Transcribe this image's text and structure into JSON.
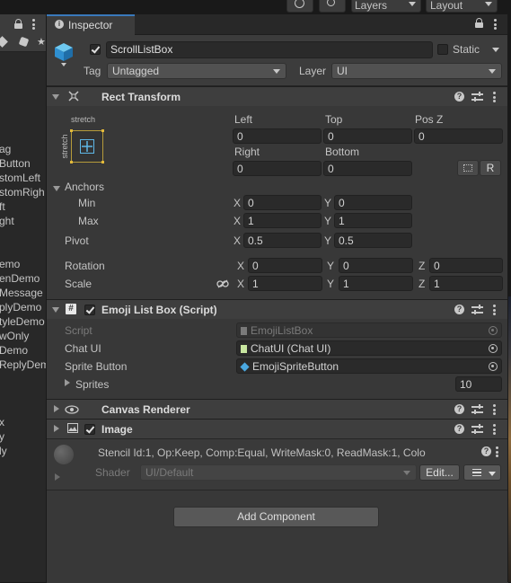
{
  "topbar": {
    "layers_label": "Layers",
    "layout_label": "Layout"
  },
  "hierarchy": {
    "items": [
      "ag",
      "Button",
      "stomLeft",
      "stomRigh",
      "ft",
      "ght",
      "emo",
      "enDemo",
      "Message",
      "plyDemo",
      "tyleDemo",
      "wOnly",
      "Demo",
      "ReplyDem",
      "x",
      "y",
      "ly"
    ]
  },
  "inspector": {
    "tab_label": "Inspector",
    "object": {
      "name": "ScrollListBox",
      "active": true,
      "static_label": "Static",
      "static": false,
      "tag_label": "Tag",
      "tag_value": "Untagged",
      "layer_label": "Layer",
      "layer_value": "UI"
    },
    "rect_transform": {
      "title": "Rect Transform",
      "anchor_preset_h": "stretch",
      "anchor_preset_v": "stretch",
      "left_label": "Left",
      "left": "0",
      "top_label": "Top",
      "top": "0",
      "posz_label": "Pos Z",
      "posz": "0",
      "right_label": "Right",
      "right": "0",
      "bottom_label": "Bottom",
      "bottom": "0",
      "r_button": "R",
      "anchors_label": "Anchors",
      "min_label": "Min",
      "min_x": "0",
      "min_y": "0",
      "max_label": "Max",
      "max_x": "1",
      "max_y": "1",
      "pivot_label": "Pivot",
      "pivot_x": "0.5",
      "pivot_y": "0.5",
      "rotation_label": "Rotation",
      "rot_x": "0",
      "rot_y": "0",
      "rot_z": "0",
      "scale_label": "Scale",
      "scale_x": "1",
      "scale_y": "1",
      "scale_z": "1",
      "x": "X",
      "y": "Y",
      "z": "Z"
    },
    "emoji_list_box": {
      "title": "Emoji List Box (Script)",
      "enabled": true,
      "script_label": "Script",
      "script_value": "EmojiListBox",
      "chatui_label": "Chat UI",
      "chatui_value": "ChatUI (Chat UI)",
      "sprite_button_label": "Sprite Button",
      "sprite_button_value": "EmojiSpriteButton",
      "sprites_label": "Sprites",
      "sprites_value": "10"
    },
    "canvas_renderer": {
      "title": "Canvas Renderer"
    },
    "image": {
      "title": "Image",
      "enabled": true,
      "stencil_text": "Stencil Id:1, Op:Keep, Comp:Equal, WriteMask:0, ReadMask:1, Colo",
      "shader_label": "Shader",
      "shader_value": "UI/Default",
      "edit_button": "Edit..."
    },
    "add_component_label": "Add Component"
  },
  "colors": {
    "accent": "#3a79bb",
    "panel": "#383838",
    "header": "#3e3e3e",
    "field": "#2a2a2a"
  }
}
